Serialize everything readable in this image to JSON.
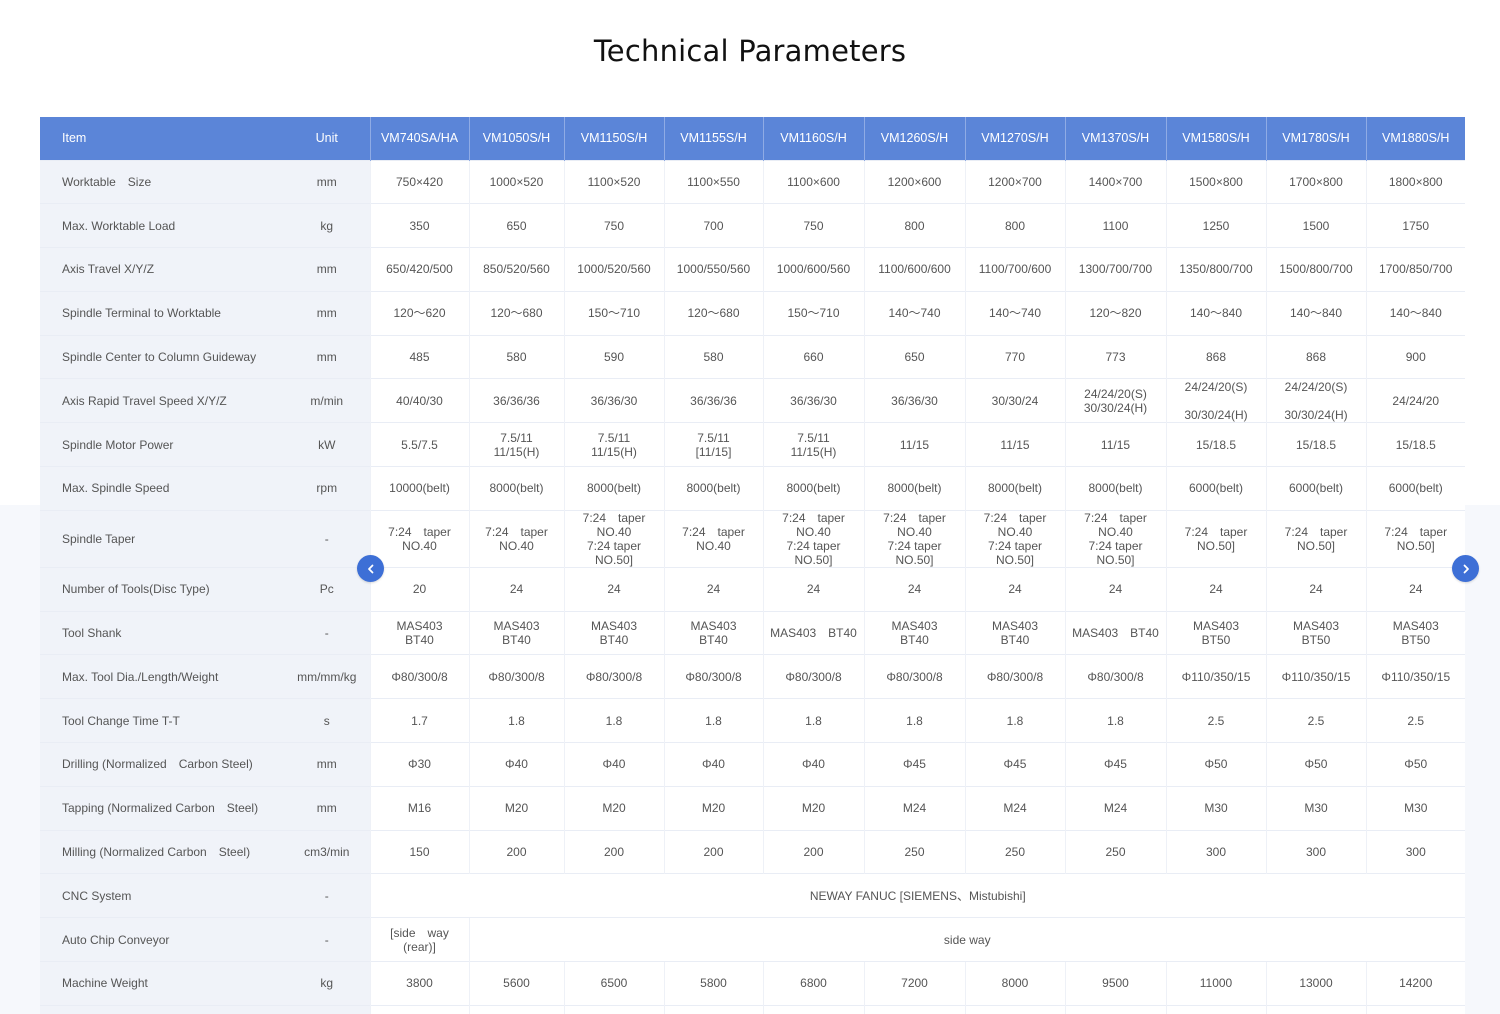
{
  "title": "Technical Parameters",
  "table": {
    "item_header": "Item",
    "unit_header": "Unit",
    "models": [
      "VM740SA/HA",
      "VM1050S/H",
      "VM1150S/H",
      "VM1155S/H",
      "VM1160S/H",
      "VM1260S/H",
      "VM1270S/H",
      "VM1370S/H",
      "VM1580S/H",
      "VM1780S/H",
      "VM1880S/H"
    ],
    "rows": [
      {
        "item": "Worktable　Size",
        "unit": "mm",
        "values": [
          "750×420",
          "1000×520",
          "1100×520",
          "1100×550",
          "1100×600",
          "1200×600",
          "1200×700",
          "1400×700",
          "1500×800",
          "1700×800",
          "1800×800"
        ]
      },
      {
        "item": "Max. Worktable Load",
        "unit": "kg",
        "values": [
          "350",
          "650",
          "750",
          "700",
          "750",
          "800",
          "800",
          "1100",
          "1250",
          "1500",
          "1750"
        ]
      },
      {
        "item": "Axis Travel X/Y/Z",
        "unit": "mm",
        "values": [
          "650/420/500",
          "850/520/560",
          "1000/520/560",
          "1000/550/560",
          "1000/600/560",
          "1100/600/600",
          "1100/700/600",
          "1300/700/700",
          "1350/800/700",
          "1500/800/700",
          "1700/850/700"
        ]
      },
      {
        "item": "Spindle Terminal to Worktable",
        "unit": "mm",
        "values": [
          "120～620",
          "120～680",
          "150～710",
          "120～680",
          "150～710",
          "140～740",
          "140～740",
          "120～820",
          "140～840",
          "140～840",
          "140～840"
        ]
      },
      {
        "item": "Spindle Center to Column Guideway",
        "unit": "mm",
        "values": [
          "485",
          "580",
          "590",
          "580",
          "660",
          "650",
          "770",
          "773",
          "868",
          "868",
          "900"
        ]
      },
      {
        "item": "Axis Rapid Travel Speed X/Y/Z",
        "unit": "m/min",
        "values": [
          "40/40/30",
          "36/36/36",
          "36/36/30",
          "36/36/36",
          "36/36/30",
          "36/36/30",
          "30/30/24",
          "24/24/20(S)\n30/30/24(H)",
          "24/24/20(S)\n\n30/30/24(H)",
          "24/24/20(S)\n\n30/30/24(H)",
          "24/24/20"
        ]
      },
      {
        "item": "Spindle Motor Power",
        "unit": "kW",
        "values": [
          "5.5/7.5",
          "7.5/11\n11/15(H)",
          "7.5/11\n11/15(H)",
          "7.5/11\n[11/15]",
          "7.5/11\n11/15(H)",
          "11/15",
          "11/15",
          "11/15",
          "15/18.5",
          "15/18.5",
          "15/18.5"
        ]
      },
      {
        "item": "Max. Spindle Speed",
        "unit": "rpm",
        "values": [
          "10000(belt)",
          "8000(belt)",
          "8000(belt)",
          "8000(belt)",
          "8000(belt)",
          "8000(belt)",
          "8000(belt)",
          "8000(belt)",
          "6000(belt)",
          "6000(belt)",
          "6000(belt)"
        ]
      },
      {
        "item": "Spindle Taper",
        "unit": "-",
        "values": [
          "7:24　taper\nNO.40",
          "7:24　taper\nNO.40",
          "7:24　taper\nNO.40\n7:24 taper\nNO.50]",
          "7:24　taper\nNO.40",
          "7:24　taper\nNO.40\n7:24 taper\nNO.50]",
          "7:24　taper\nNO.40\n7:24 taper\nNO.50]",
          "7:24　taper\nNO.40\n7:24 taper\nNO.50]",
          "7:24　taper\nNO.40\n7:24 taper\nNO.50]",
          "7:24　taper\nNO.50]",
          "7:24　taper\nNO.50]",
          "7:24　taper\nNO.50]"
        ]
      },
      {
        "item": "Number of Tools(Disc Type)",
        "unit": "Pc",
        "values": [
          "20",
          "24",
          "24",
          "24",
          "24",
          "24",
          "24",
          "24",
          "24",
          "24",
          "24"
        ]
      },
      {
        "item": "Tool Shank",
        "unit": "-",
        "values": [
          "MAS403\nBT40",
          "MAS403\nBT40",
          "MAS403\nBT40",
          "MAS403\nBT40",
          "MAS403　BT40",
          "MAS403\nBT40",
          "MAS403\nBT40",
          "MAS403　BT40",
          "MAS403\nBT50",
          "MAS403\nBT50",
          "MAS403\nBT50"
        ]
      },
      {
        "item": "Max. Tool Dia./Length/Weight",
        "unit": "mm/mm/kg",
        "values": [
          "Φ80/300/8",
          "Φ80/300/8",
          "Φ80/300/8",
          "Φ80/300/8",
          "Φ80/300/8",
          "Φ80/300/8",
          "Φ80/300/8",
          "Φ80/300/8",
          "Φ110/350/15",
          "Φ110/350/15",
          "Φ110/350/15"
        ]
      },
      {
        "item": "Tool Change Time T-T",
        "unit": "s",
        "values": [
          "1.7",
          "1.8",
          "1.8",
          "1.8",
          "1.8",
          "1.8",
          "1.8",
          "1.8",
          "2.5",
          "2.5",
          "2.5"
        ]
      },
      {
        "item": "Drilling (Normalized　Carbon Steel)",
        "unit": "mm",
        "values": [
          "Φ30",
          "Φ40",
          "Φ40",
          "Φ40",
          "Φ40",
          "Φ45",
          "Φ45",
          "Φ45",
          "Φ50",
          "Φ50",
          "Φ50"
        ]
      },
      {
        "item": "Tapping (Normalized  Carbon　Steel)",
        "unit": "mm",
        "values": [
          "M16",
          "M20",
          "M20",
          "M20",
          "M20",
          "M24",
          "M24",
          "M24",
          "M30",
          "M30",
          "M30"
        ]
      },
      {
        "item": "Milling (Normalized  Carbon　Steel)",
        "unit": "cm3/min",
        "values": [
          "150",
          "200",
          "200",
          "200",
          "200",
          "250",
          "250",
          "250",
          "300",
          "300",
          "300"
        ]
      }
    ],
    "cnc_row": {
      "item": "CNC System",
      "unit": "-",
      "value": "NEWAY FANUC [SIEMENS、Mistubishi]"
    },
    "chip_row": {
      "item": "Auto Chip Conveyor",
      "unit": "-",
      "first_value": "[side　way\n(rear)]",
      "rest_value": "side way"
    },
    "weight_row": {
      "item": "Machine Weight",
      "unit": "kg",
      "values": [
        "3800",
        "5600",
        "6500",
        "5800",
        "6800",
        "7200",
        "8000",
        "9500",
        "11000",
        "13000",
        "14200"
      ]
    }
  },
  "nav": {
    "prev_icon": "chevron-left-icon",
    "next_icon": "chevron-right-icon"
  }
}
